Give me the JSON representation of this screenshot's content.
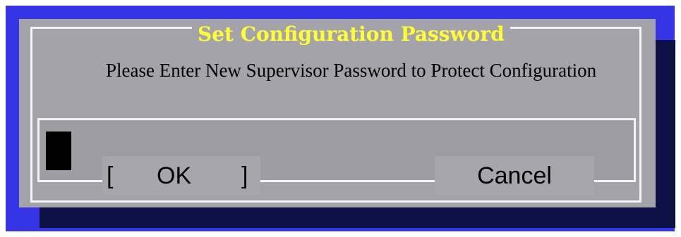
{
  "dialog": {
    "title": "Set Configuration Password",
    "message": "Please Enter New Supervisor Password to Protect Configuration",
    "password_value": "",
    "buttons": {
      "ok": {
        "bracket_left": "[",
        "label": "OK",
        "bracket_right": "]"
      },
      "cancel": {
        "label": "Cancel"
      }
    }
  },
  "colors": {
    "screen_background": "#3535e6",
    "dialog_background": "#a4a3aa",
    "shadow": "#0c1045",
    "title_text": "#ffff33",
    "frame_lines": "#f4f4f4",
    "cursor": "#000000"
  }
}
